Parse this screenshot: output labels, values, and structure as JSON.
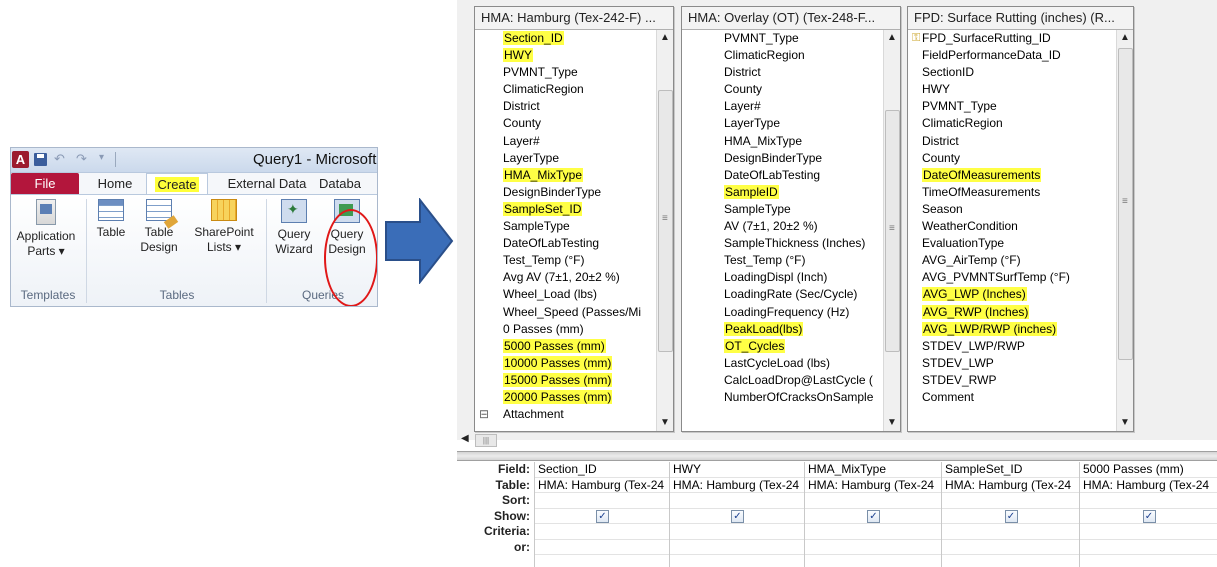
{
  "ribbon": {
    "app_icon": "A",
    "window_title": "Query1 - Microsoft",
    "tabs": {
      "file": "File",
      "home": "Home",
      "create": "Create",
      "external_data": "External Data",
      "database": "Databa"
    },
    "buttons": {
      "application_parts": "Application\nParts ▾",
      "table": "Table",
      "table_design": "Table\nDesign",
      "sharepoint_lists": "SharePoint\nLists ▾",
      "query_wizard": "Query\nWizard",
      "query_design": "Query\nDesign"
    },
    "groups": {
      "templates": "Templates",
      "tables": "Tables",
      "queries": "Queries"
    }
  },
  "tables": [
    {
      "title": "HMA: Hamburg (Tex-242-F) ...",
      "fields": [
        {
          "name": "Section_ID",
          "highlight": true
        },
        {
          "name": "HWY",
          "highlight": true
        },
        {
          "name": "PVMNT_Type",
          "highlight": false
        },
        {
          "name": "ClimaticRegion",
          "highlight": false
        },
        {
          "name": "District",
          "highlight": false
        },
        {
          "name": "County",
          "highlight": false
        },
        {
          "name": "Layer#",
          "highlight": false
        },
        {
          "name": "LayerType",
          "highlight": false
        },
        {
          "name": "HMA_MixType",
          "highlight": true
        },
        {
          "name": "DesignBinderType",
          "highlight": false
        },
        {
          "name": "SampleSet_ID",
          "highlight": true
        },
        {
          "name": "SampleType",
          "highlight": false
        },
        {
          "name": "DateOfLabTesting",
          "highlight": false
        },
        {
          "name": "Test_Temp (°F)",
          "highlight": false
        },
        {
          "name": "Avg AV (7±1, 20±2 %)",
          "highlight": false
        },
        {
          "name": "Wheel_Load (lbs)",
          "highlight": false
        },
        {
          "name": "Wheel_Speed (Passes/Mi",
          "highlight": false
        },
        {
          "name": "0 Passes (mm)",
          "highlight": false
        },
        {
          "name": "5000 Passes (mm)",
          "highlight": true
        },
        {
          "name": "10000 Passes (mm)",
          "highlight": true
        },
        {
          "name": "15000 Passes (mm)",
          "highlight": true
        },
        {
          "name": "20000 Passes (mm)",
          "highlight": true
        },
        {
          "name": "Attachment",
          "highlight": false
        }
      ]
    },
    {
      "title": "HMA: Overlay (OT) (Tex-248-F...",
      "fields": [
        {
          "name": "PVMNT_Type",
          "highlight": false
        },
        {
          "name": "ClimaticRegion",
          "highlight": false
        },
        {
          "name": "District",
          "highlight": false
        },
        {
          "name": "County",
          "highlight": false
        },
        {
          "name": "Layer#",
          "highlight": false
        },
        {
          "name": "LayerType",
          "highlight": false
        },
        {
          "name": "HMA_MixType",
          "highlight": false
        },
        {
          "name": "DesignBinderType",
          "highlight": false
        },
        {
          "name": "DateOfLabTesting",
          "highlight": false
        },
        {
          "name": "SampleID",
          "highlight": true
        },
        {
          "name": "SampleType",
          "highlight": false
        },
        {
          "name": "AV (7±1, 20±2 %)",
          "highlight": false
        },
        {
          "name": "SampleThickness (Inches)",
          "highlight": false
        },
        {
          "name": "Test_Temp (°F)",
          "highlight": false
        },
        {
          "name": "LoadingDispl (Inch)",
          "highlight": false
        },
        {
          "name": "LoadingRate (Sec/Cycle)",
          "highlight": false
        },
        {
          "name": "LoadingFrequency (Hz)",
          "highlight": false
        },
        {
          "name": "PeakLoad(lbs)",
          "highlight": true
        },
        {
          "name": "OT_Cycles",
          "highlight": true
        },
        {
          "name": "LastCycleLoad (lbs)",
          "highlight": false
        },
        {
          "name": "CalcLoadDrop@LastCycle (",
          "highlight": false
        },
        {
          "name": "NumberOfCracksOnSample",
          "highlight": false
        }
      ]
    },
    {
      "title": "FPD: Surface Rutting (inches) (R...",
      "fields": [
        {
          "name": "FPD_SurfaceRutting_ID",
          "highlight": false,
          "key": true
        },
        {
          "name": "FieldPerformanceData_ID",
          "highlight": false
        },
        {
          "name": "SectionID",
          "highlight": false
        },
        {
          "name": "HWY",
          "highlight": false
        },
        {
          "name": "PVMNT_Type",
          "highlight": false
        },
        {
          "name": "ClimaticRegion",
          "highlight": false
        },
        {
          "name": "District",
          "highlight": false
        },
        {
          "name": "County",
          "highlight": false
        },
        {
          "name": "DateOfMeasurements",
          "highlight": true
        },
        {
          "name": "TimeOfMeasurements",
          "highlight": false
        },
        {
          "name": "Season",
          "highlight": false
        },
        {
          "name": "WeatherCondition",
          "highlight": false
        },
        {
          "name": "EvaluationType",
          "highlight": false
        },
        {
          "name": "AVG_AirTemp (°F)",
          "highlight": false
        },
        {
          "name": "AVG_PVMNTSurfTemp (°F)",
          "highlight": false
        },
        {
          "name": "AVG_LWP (Inches)",
          "highlight": true
        },
        {
          "name": "AVG_RWP (Inches)",
          "highlight": true
        },
        {
          "name": "AVG_LWP/RWP (inches)",
          "highlight": true
        },
        {
          "name": "STDEV_LWP/RWP",
          "highlight": false
        },
        {
          "name": "STDEV_LWP",
          "highlight": false
        },
        {
          "name": "STDEV_RWP",
          "highlight": false
        },
        {
          "name": "Comment",
          "highlight": false
        }
      ]
    }
  ],
  "grid": {
    "row_labels": [
      "Field:",
      "Table:",
      "Sort:",
      "Show:",
      "Criteria:",
      "or:"
    ],
    "columns": [
      {
        "field": "Section_ID",
        "table": "HMA: Hamburg (Tex-24",
        "show": true
      },
      {
        "field": "HWY",
        "table": "HMA: Hamburg (Tex-24",
        "show": true
      },
      {
        "field": "HMA_MixType",
        "table": "HMA: Hamburg (Tex-24",
        "show": true
      },
      {
        "field": "SampleSet_ID",
        "table": "HMA: Hamburg (Tex-24",
        "show": true
      },
      {
        "field": "5000 Passes (mm)",
        "table": "HMA: Hamburg (Tex-24",
        "show": true
      }
    ]
  },
  "colors": {
    "highlight": "#ffff45",
    "file_tab": "#b3163c",
    "annotation_circle": "#e01818",
    "arrow": "#3a6db8"
  }
}
